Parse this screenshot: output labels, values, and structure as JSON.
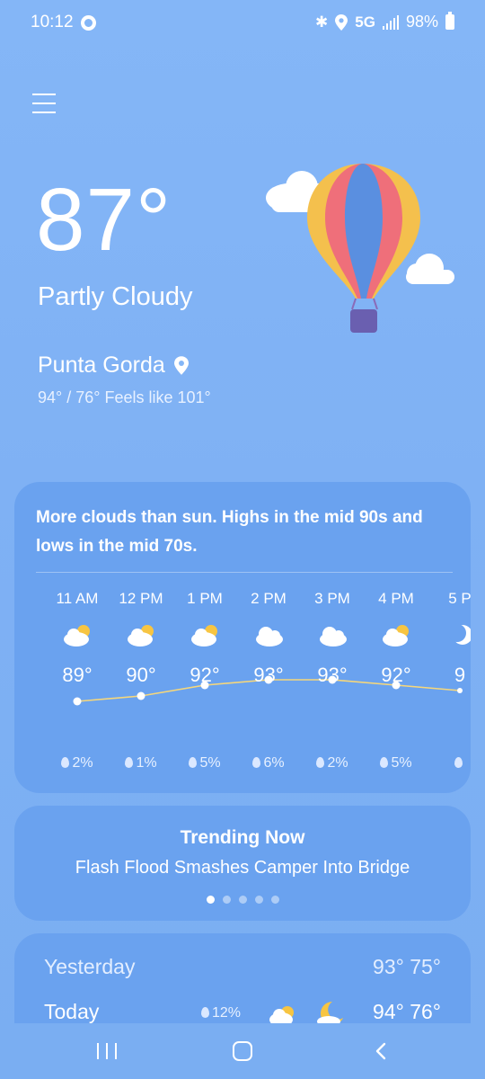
{
  "status_bar": {
    "time": "10:12",
    "network": "5G",
    "battery": "98%"
  },
  "current": {
    "temperature": "87°",
    "condition": "Partly Cloudy",
    "location": "Punta Gorda",
    "hilo_feels": "94° / 76° Feels like 101°"
  },
  "forecast": {
    "summary": "More clouds than sun. Highs in the mid 90s and lows in the mid 70s.",
    "hours": [
      {
        "time": "11 AM",
        "temp": "89°",
        "precip": "2%",
        "icon": "partly-sunny-icon",
        "value": 89
      },
      {
        "time": "12 PM",
        "temp": "90°",
        "precip": "1%",
        "icon": "partly-sunny-icon",
        "value": 90
      },
      {
        "time": "1 PM",
        "temp": "92°",
        "precip": "5%",
        "icon": "partly-sunny-icon",
        "value": 92
      },
      {
        "time": "2 PM",
        "temp": "93°",
        "precip": "6%",
        "icon": "cloud-icon",
        "value": 93
      },
      {
        "time": "3 PM",
        "temp": "93°",
        "precip": "2%",
        "icon": "cloud-icon",
        "value": 93
      },
      {
        "time": "4 PM",
        "temp": "92°",
        "precip": "5%",
        "icon": "partly-sunny-icon",
        "value": 92
      },
      {
        "time": "5 P",
        "temp": "9",
        "precip": "",
        "icon": "moon-cloud-icon",
        "value": 91
      }
    ]
  },
  "trending": {
    "title": "Trending Now",
    "headline": "Flash Flood Smashes Camper Into Bridge",
    "pages": 5,
    "active_page": 1
  },
  "daily": [
    {
      "day": "Yesterday",
      "temps": "93° 75°",
      "precip": ""
    },
    {
      "day": "Today",
      "temps": "94° 76°",
      "precip": "12%"
    }
  ],
  "colors": {
    "background": "#84b6f7",
    "card": "#6aa2ef",
    "trend_line": "#f6d77a",
    "sun": "#f7c542"
  }
}
